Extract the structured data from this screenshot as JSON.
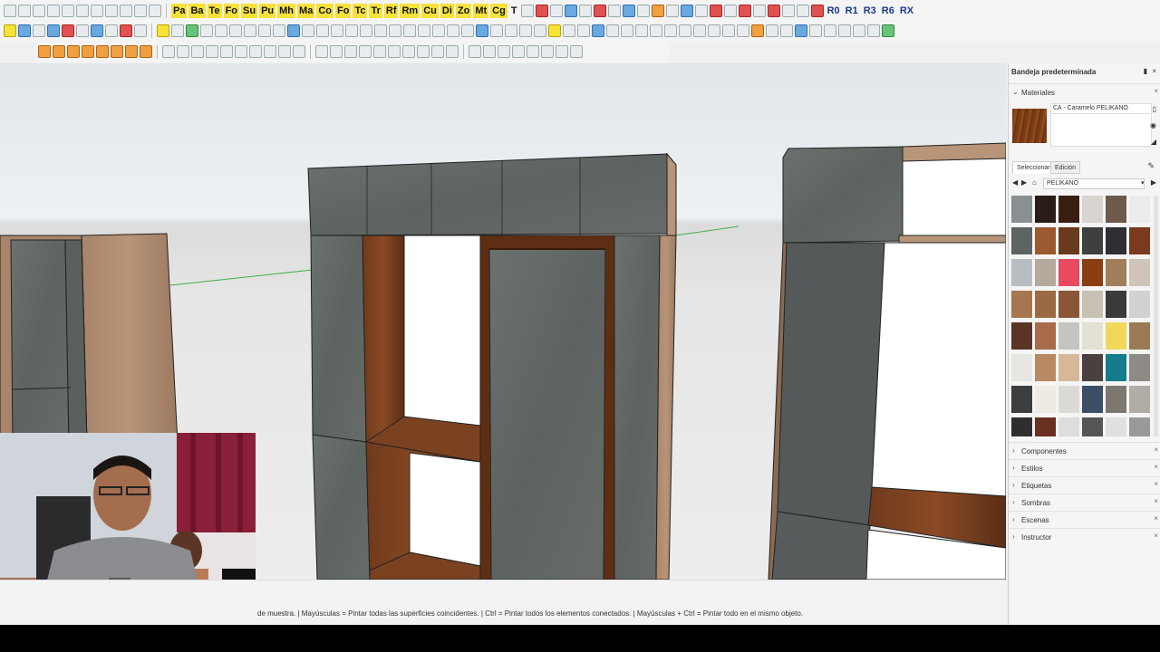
{
  "toolbar_letters": [
    "Pa",
    "Ba",
    "Te",
    "Fo",
    "Su",
    "Pu",
    "Mh",
    "Ma",
    "Co",
    "Fo",
    "Tc",
    "Tr",
    "Rf",
    "Rm",
    "Cu",
    "Di",
    "Zo",
    "Mt",
    "Cg",
    "T"
  ],
  "toolbar_right_letters": [
    "R0",
    "R1",
    "R3",
    "R6",
    "RX"
  ],
  "status": {
    "hint": "de muestra. | Mayúsculas = Pintar todas las superficies coincidentes. | Ctrl = Pintar todos los elementos conectados. | Mayúsculas + Ctrl = Pintar todo en el mismo objeto."
  },
  "tray": {
    "title": "Bandeja predeterminada",
    "materials_panel": {
      "label": "Materiales",
      "current_material": "CA - Caramelo PELIKANO",
      "tabs": [
        "Seleccionar",
        "Edición"
      ],
      "library": "PELIKANO",
      "swatches": [
        "#8b8f92",
        "#2a1c16",
        "#3a1e12",
        "#d8d4cf",
        "#6e5a4c",
        "#ececec",
        "#5d6560",
        "#9a5a2e",
        "#6a3a1e",
        "#3d3f41",
        "#2f2f33",
        "#7a3a1e",
        "#b8bdc2",
        "#b3a99c",
        "#e84a5f",
        "#8a3e12",
        "#a07e5c",
        "#cfc4b8",
        "#a8764e",
        "#9a6a44",
        "#8a5636",
        "#c9c0b4",
        "#3a3a3c",
        "#cfd1d2",
        "#5a3426",
        "#a86a48",
        "#c4c4c2",
        "#e3e0d4",
        "#f2d85a",
        "#9a7a52",
        "#e8e6e2",
        "#b88a64",
        "#d6b898",
        "#4a4040",
        "#157c8c",
        "#8e8a86",
        "#3c3e40",
        "#eeebe2",
        "#dcdad6",
        "#3a4e66",
        "#7e7770",
        "#b0aca6",
        "#2e2e2e",
        "#6a3020",
        "#ddd",
        "#555",
        "#e0e0e0",
        "#999"
      ]
    },
    "panels": [
      "Componentes",
      "Estilos",
      "Etiquetas",
      "Sombras",
      "Escenas",
      "Instructor"
    ]
  }
}
